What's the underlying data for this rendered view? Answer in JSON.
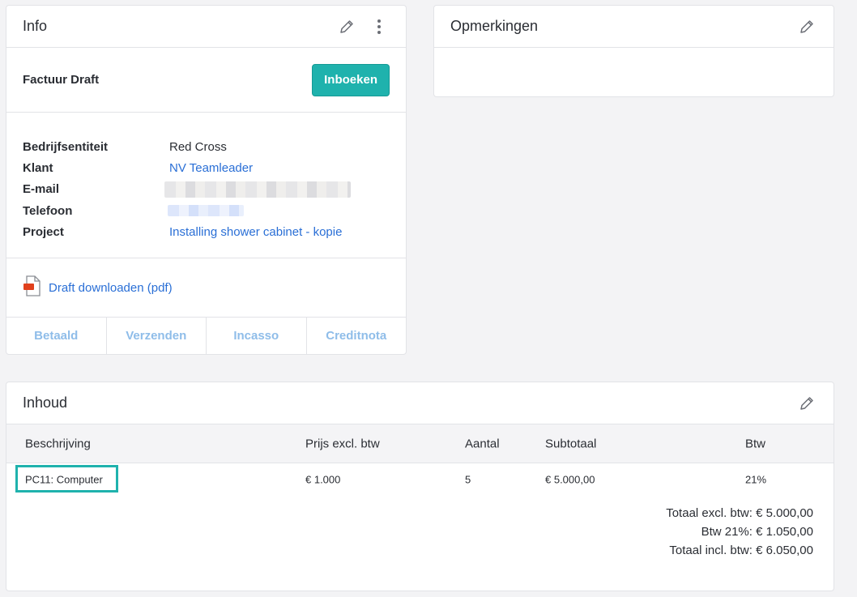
{
  "info": {
    "title": "Info",
    "status_label": "Factuur Draft",
    "book_button": "Inboeken",
    "details": [
      {
        "label": "Bedrijfsentiteit",
        "value": "Red Cross"
      },
      {
        "label": "Klant",
        "value": "NV Teamleader"
      },
      {
        "label": "E-mail",
        "value": ""
      },
      {
        "label": "Telefoon",
        "value": ""
      },
      {
        "label": "Project",
        "value": "Installing shower cabinet - kopie"
      }
    ],
    "download_link": "Draft downloaden (pdf)",
    "actions": [
      "Betaald",
      "Verzenden",
      "Incasso",
      "Creditnota"
    ]
  },
  "notes": {
    "title": "Opmerkingen"
  },
  "content": {
    "title": "Inhoud",
    "columns": [
      "Beschrijving",
      "Prijs excl. btw",
      "Aantal",
      "Subtotaal",
      "Btw"
    ],
    "rows": [
      {
        "description": "PC11: Computer",
        "price": "€ 1.000",
        "quantity": "5",
        "subtotal": "€ 5.000,00",
        "vat": "21%"
      }
    ],
    "totals": {
      "excl": "Totaal excl. btw: € 5.000,00",
      "vat": "Btw 21%: € 1.050,00",
      "incl": "Totaal incl. btw: € 6.050,00"
    }
  },
  "icons": {
    "edit": "pencil-icon",
    "more": "more-vertical-icon",
    "pdf": "pdf-file-icon"
  },
  "colors": {
    "accent": "#1fb2ad",
    "link": "#2a6fd6",
    "action_disabled": "#8fbde9"
  }
}
